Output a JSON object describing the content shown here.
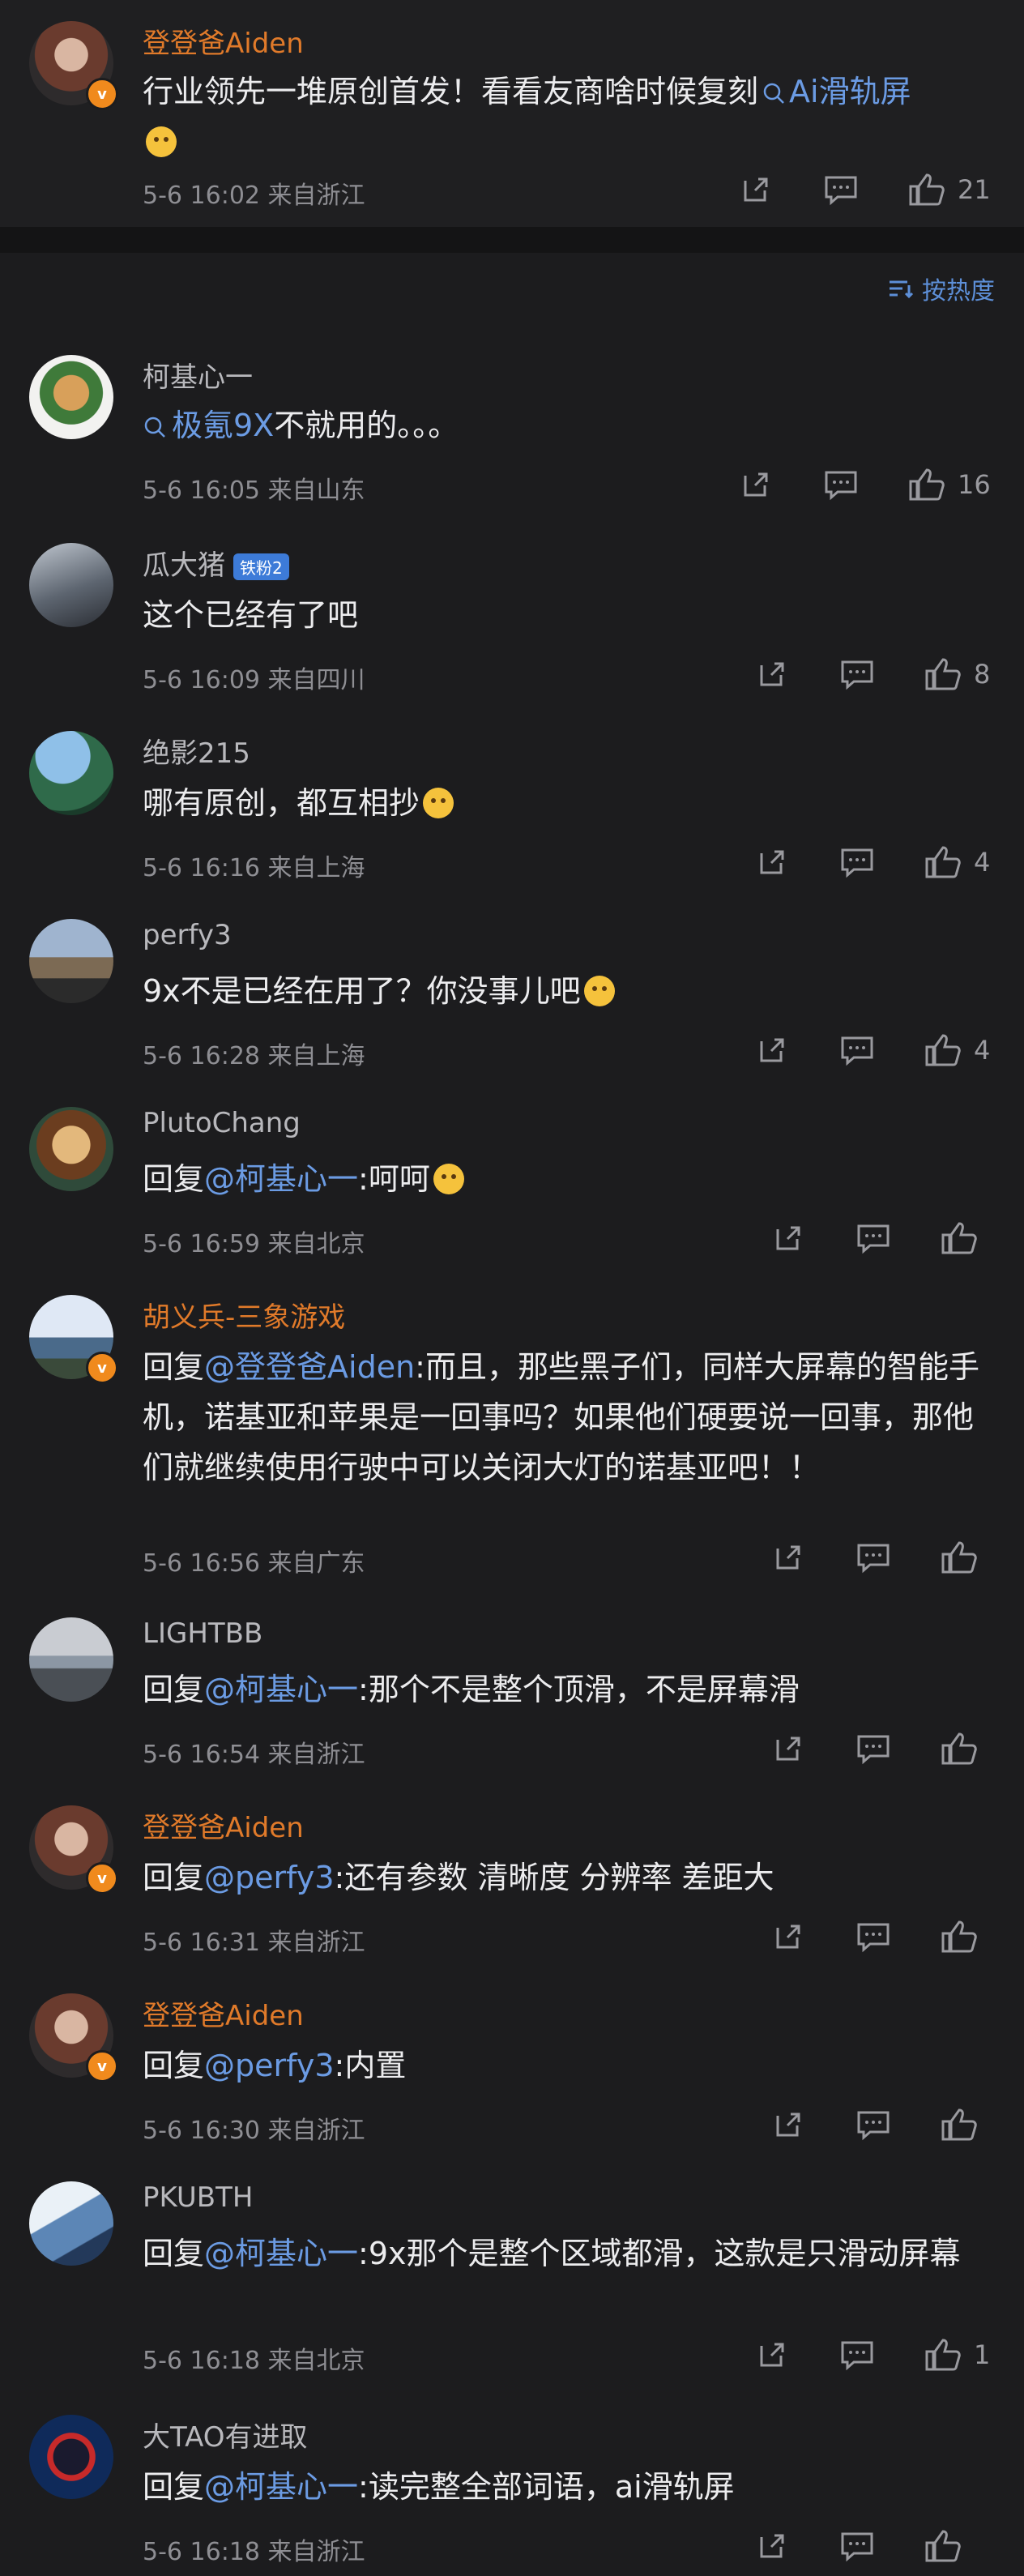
{
  "colors": {
    "background": "#1c1c1e",
    "link": "#6b9be3",
    "vip_name": "#e07a2a",
    "badge": "#f08a1d"
  },
  "post": {
    "author": "登登爸Aiden",
    "text_main": "行业领先一堆原创首发！看看友商啥时候复刻",
    "search_link": "Ai滑轨屏",
    "meta": "5-6 16:02 来自浙江",
    "likes": "21",
    "icons": [
      "share-icon",
      "comment-icon",
      "like-icon"
    ]
  },
  "sort": {
    "label": "按热度"
  },
  "comments": [
    {
      "name": "柯基心一",
      "prefix": "",
      "link": "极氪9X",
      "text": "不就用的。。。",
      "meta": "5-6 16:05 来自山东",
      "likes": "16"
    },
    {
      "name": "瓜大猪",
      "badge": "铁粉2",
      "prefix": "",
      "link": "",
      "text": "这个已经有了吧",
      "meta": "5-6 16:09 来自四川",
      "likes": "8"
    },
    {
      "name": "绝影215",
      "prefix": "",
      "link": "",
      "text": "哪有原创，都互相抄",
      "meta": "5-6 16:16 来自上海",
      "likes": "4"
    },
    {
      "name": "perfy3",
      "prefix": "",
      "link": "",
      "text": "9x不是已经在用了？你没事儿吧",
      "meta": "5-6 16:28 来自上海",
      "likes": "4"
    },
    {
      "name": "PlutoChang",
      "prefix": "回复",
      "link": "@柯基心一",
      "text": ":呵呵",
      "meta": "5-6 16:59 来自北京",
      "likes": ""
    },
    {
      "name": "胡义兵-三象游戏",
      "prefix": "回复",
      "link": "@登登爸Aiden",
      "text": ":而且，那些黑子们，同样大屏幕的智能手机，诺基亚和苹果是一回事吗？如果他们硬要说一回事，那他们就继续使用行驶中可以关闭大灯的诺基亚吧！！",
      "meta": "5-6 16:56 来自广东",
      "likes": ""
    },
    {
      "name": "LIGHTBB",
      "prefix": "回复",
      "link": "@柯基心一",
      "text": ":那个不是整个顶滑，不是屏幕滑",
      "meta": "5-6 16:54 来自浙江",
      "likes": ""
    },
    {
      "name": "登登爸Aiden",
      "prefix": "回复",
      "link": "@perfy3",
      "text": ":还有参数 清晰度 分辨率 差距大",
      "meta": "5-6 16:31 来自浙江",
      "likes": ""
    },
    {
      "name": "登登爸Aiden",
      "prefix": "回复",
      "link": "@perfy3",
      "text": ":内置",
      "meta": "5-6 16:30 来自浙江",
      "likes": ""
    },
    {
      "name": "PKUBTH",
      "prefix": "回复",
      "link": "@柯基心一",
      "text": ":9x那个是整个区域都滑，这款是只滑动屏幕",
      "meta": "5-6 16:18 来自北京",
      "likes": "1"
    },
    {
      "name": "大TAO有进取",
      "prefix": "回复",
      "link": "@柯基心一",
      "text": ":读完整全部词语，ai滑轨屏",
      "meta": "5-6 16:18 来自浙江",
      "likes": ""
    }
  ]
}
